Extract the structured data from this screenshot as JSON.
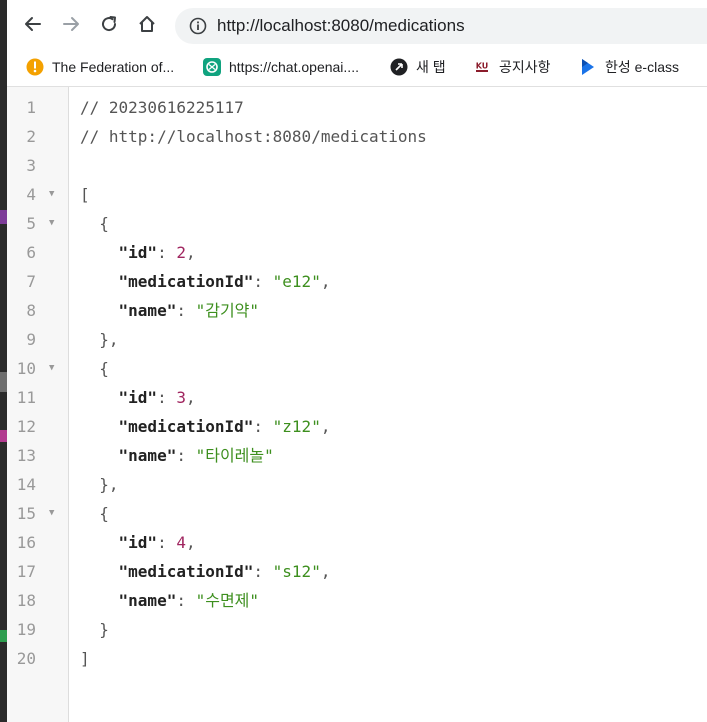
{
  "browser": {
    "url": "http://localhost:8080/medications",
    "nav": {
      "back_icon": "back-arrow-icon",
      "forward_icon": "forward-arrow-icon",
      "reload_icon": "reload-icon",
      "home_icon": "home-icon",
      "info_icon": "info-icon"
    },
    "bookmarks": [
      {
        "label": "The Federation of...",
        "icon": "federation-icon",
        "color": "#f4a100"
      },
      {
        "label": "https://chat.openai....",
        "icon": "openai-icon",
        "color": "#10a37f"
      },
      {
        "label": "새 탭",
        "icon": "new-tab-icon",
        "color": "#202124"
      },
      {
        "label": "공지사항",
        "icon": "ku-icon",
        "color": "#8b1c2b"
      },
      {
        "label": "한성 e-class",
        "icon": "eclass-icon",
        "color": "#1a73e8"
      }
    ]
  },
  "viewer": {
    "lines": [
      {
        "n": "1",
        "fold": "",
        "segments": [
          {
            "t": "// 20230616225117",
            "c": "comment"
          }
        ]
      },
      {
        "n": "2",
        "fold": "",
        "segments": [
          {
            "t": "// http://localhost:8080/medications",
            "c": "comment"
          }
        ]
      },
      {
        "n": "3",
        "fold": "",
        "segments": []
      },
      {
        "n": "4",
        "fold": "▼",
        "segments": [
          {
            "t": "[",
            "c": "punct"
          }
        ]
      },
      {
        "n": "5",
        "fold": "▼",
        "segments": [
          {
            "t": "  {",
            "c": "punct"
          }
        ]
      },
      {
        "n": "6",
        "fold": "",
        "segments": [
          {
            "t": "    ",
            "c": "punct"
          },
          {
            "t": "\"id\"",
            "c": "key"
          },
          {
            "t": ": ",
            "c": "punct"
          },
          {
            "t": "2",
            "c": "num"
          },
          {
            "t": ",",
            "c": "punct"
          }
        ]
      },
      {
        "n": "7",
        "fold": "",
        "segments": [
          {
            "t": "    ",
            "c": "punct"
          },
          {
            "t": "\"medicationId\"",
            "c": "key"
          },
          {
            "t": ": ",
            "c": "punct"
          },
          {
            "t": "\"e12\"",
            "c": "str"
          },
          {
            "t": ",",
            "c": "punct"
          }
        ]
      },
      {
        "n": "8",
        "fold": "",
        "segments": [
          {
            "t": "    ",
            "c": "punct"
          },
          {
            "t": "\"name\"",
            "c": "key"
          },
          {
            "t": ": ",
            "c": "punct"
          },
          {
            "t": "\"감기약\"",
            "c": "str"
          }
        ]
      },
      {
        "n": "9",
        "fold": "",
        "segments": [
          {
            "t": "  },",
            "c": "punct"
          }
        ]
      },
      {
        "n": "10",
        "fold": "▼",
        "segments": [
          {
            "t": "  {",
            "c": "punct"
          }
        ]
      },
      {
        "n": "11",
        "fold": "",
        "segments": [
          {
            "t": "    ",
            "c": "punct"
          },
          {
            "t": "\"id\"",
            "c": "key"
          },
          {
            "t": ": ",
            "c": "punct"
          },
          {
            "t": "3",
            "c": "num"
          },
          {
            "t": ",",
            "c": "punct"
          }
        ]
      },
      {
        "n": "12",
        "fold": "",
        "segments": [
          {
            "t": "    ",
            "c": "punct"
          },
          {
            "t": "\"medicationId\"",
            "c": "key"
          },
          {
            "t": ": ",
            "c": "punct"
          },
          {
            "t": "\"z12\"",
            "c": "str"
          },
          {
            "t": ",",
            "c": "punct"
          }
        ]
      },
      {
        "n": "13",
        "fold": "",
        "segments": [
          {
            "t": "    ",
            "c": "punct"
          },
          {
            "t": "\"name\"",
            "c": "key"
          },
          {
            "t": ": ",
            "c": "punct"
          },
          {
            "t": "\"타이레놀\"",
            "c": "str"
          }
        ]
      },
      {
        "n": "14",
        "fold": "",
        "segments": [
          {
            "t": "  },",
            "c": "punct"
          }
        ]
      },
      {
        "n": "15",
        "fold": "▼",
        "segments": [
          {
            "t": "  {",
            "c": "punct"
          }
        ]
      },
      {
        "n": "16",
        "fold": "",
        "segments": [
          {
            "t": "    ",
            "c": "punct"
          },
          {
            "t": "\"id\"",
            "c": "key"
          },
          {
            "t": ": ",
            "c": "punct"
          },
          {
            "t": "4",
            "c": "num"
          },
          {
            "t": ",",
            "c": "punct"
          }
        ]
      },
      {
        "n": "17",
        "fold": "",
        "segments": [
          {
            "t": "    ",
            "c": "punct"
          },
          {
            "t": "\"medicationId\"",
            "c": "key"
          },
          {
            "t": ": ",
            "c": "punct"
          },
          {
            "t": "\"s12\"",
            "c": "str"
          },
          {
            "t": ",",
            "c": "punct"
          }
        ]
      },
      {
        "n": "18",
        "fold": "",
        "segments": [
          {
            "t": "    ",
            "c": "punct"
          },
          {
            "t": "\"name\"",
            "c": "key"
          },
          {
            "t": ": ",
            "c": "punct"
          },
          {
            "t": "\"수면제\"",
            "c": "str"
          }
        ]
      },
      {
        "n": "19",
        "fold": "",
        "segments": [
          {
            "t": "  }",
            "c": "punct"
          }
        ]
      },
      {
        "n": "20",
        "fold": "",
        "segments": [
          {
            "t": "]",
            "c": "punct"
          }
        ]
      }
    ]
  }
}
